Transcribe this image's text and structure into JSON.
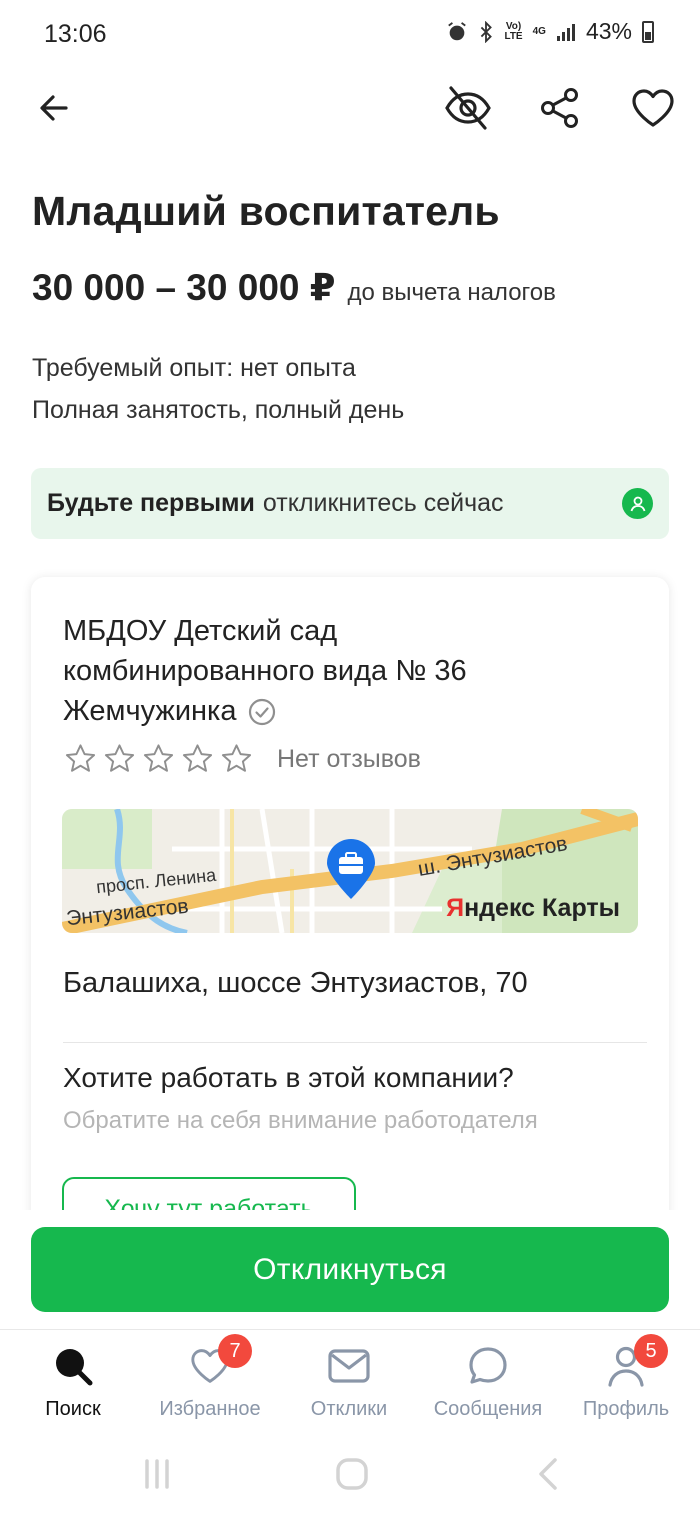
{
  "status_bar": {
    "time": "13:06",
    "network_top": "Vo)",
    "network_bottom": "LTE",
    "net_type": "4G",
    "battery": "43%"
  },
  "header": {
    "back_icon": "arrow-left-icon",
    "hide_icon": "eye-off-icon",
    "share_icon": "share-icon",
    "favorite_icon": "heart-icon"
  },
  "vacancy": {
    "title": "Младший воспитатель",
    "salary": "30 000 – 30 000 ₽",
    "salary_note": "до вычета налогов",
    "experience": "Требуемый опыт: нет опыта",
    "employment": "Полная занятость, полный день"
  },
  "banner": {
    "strong": "Будьте первыми",
    "rest": "откликнитесь сейчас",
    "icon": "user-circle-icon"
  },
  "company": {
    "name": "МБДОУ Детский сад комбинированного вида № 36 Жемчужинка",
    "verified_icon": "check-circle-icon",
    "rating_stars": 0,
    "reviews": "Нет отзывов",
    "map": {
      "label_avenue": "просп. Ленина",
      "label_highway": "ш. Энтузиастов",
      "label_street": "Энтузиастов",
      "brand_red": "Я",
      "brand_rest": "ндекс Карты",
      "pin_icon": "briefcase-pin-icon"
    },
    "address": "Балашиха, шоссе Энтузиастов, 70",
    "want_title": "Хотите работать в этой компании?",
    "want_hint": "Обратите на себя внимание работодателя",
    "want_button": "Хочу тут работать"
  },
  "actions": {
    "respond": "Откликнуться"
  },
  "bottom_nav": {
    "items": [
      {
        "label": "Поиск",
        "icon": "search-icon",
        "active": true
      },
      {
        "label": "Избранное",
        "icon": "heart-icon",
        "badge": "7"
      },
      {
        "label": "Отклики",
        "icon": "mail-icon"
      },
      {
        "label": "Сообщения",
        "icon": "chat-icon"
      },
      {
        "label": "Профиль",
        "icon": "user-icon",
        "badge": "5"
      }
    ]
  },
  "colors": {
    "accent": "#16b84e",
    "banner_bg": "#e8f6ec",
    "badge": "#f2493d",
    "nav_inactive": "#8a96a8"
  }
}
